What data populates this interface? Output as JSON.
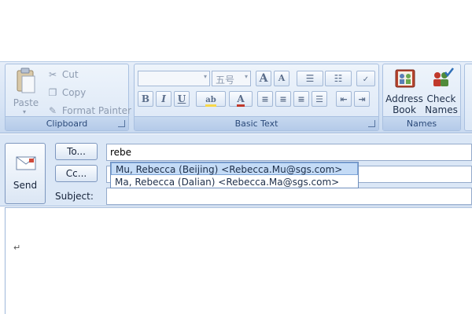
{
  "ribbon": {
    "clipboard": {
      "label": "Clipboard",
      "paste": "Paste",
      "cut": "Cut",
      "copy": "Copy",
      "format_painter": "Format Painter"
    },
    "basic_text": {
      "label": "Basic Text",
      "font_size": "五号"
    },
    "names": {
      "label": "Names",
      "address_book": [
        "Address",
        "Book"
      ],
      "check_names": [
        "Check",
        "Names"
      ]
    }
  },
  "message": {
    "send": "Send",
    "to_button": "To...",
    "cc_button": "Cc...",
    "subject_label": "Subject:",
    "to_value": "rebe",
    "suggestions": [
      "Mu, Rebecca (Beijing)  <Rebecca.Mu@sgs.com>",
      "Ma, Rebecca (Dalian)  <Rebecca.Ma@sgs.com>"
    ],
    "body_mark": "↵"
  },
  "colors": {
    "ribbon_bg": "#d7e4f5",
    "selection": "#c4dbf6",
    "highlight": "#f7d84a",
    "font_color": "#c0392b"
  }
}
